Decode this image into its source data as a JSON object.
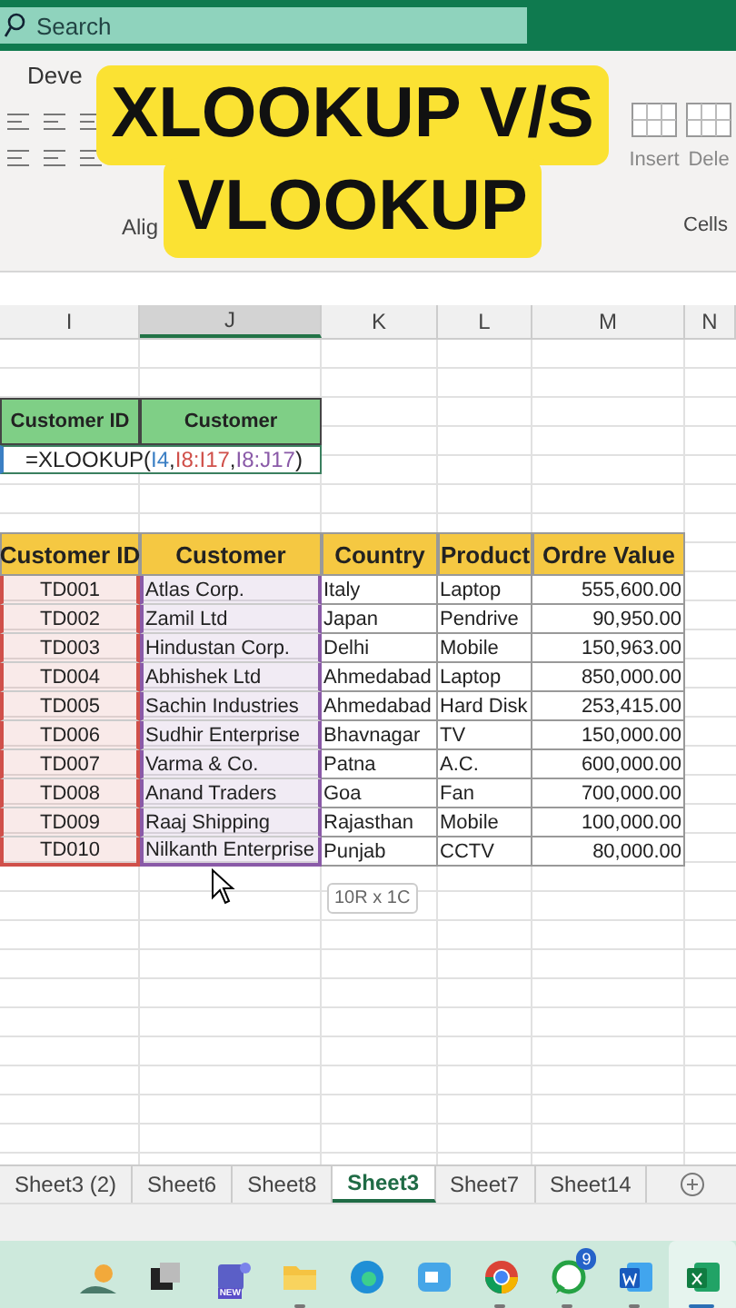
{
  "search": {
    "placeholder": "Search"
  },
  "ribbon": {
    "tab": "Deve",
    "alignment_group": "Alig",
    "insert_button": "Insert",
    "delete_button": "Dele",
    "cells_group": "Cells"
  },
  "title_overlay": {
    "lines": [
      "XLOOKUP V/S",
      "VLOOKUP"
    ]
  },
  "columns": [
    {
      "letter": "I",
      "selected": false
    },
    {
      "letter": "J",
      "selected": true
    },
    {
      "letter": "K",
      "selected": false
    },
    {
      "letter": "L",
      "selected": false
    },
    {
      "letter": "M",
      "selected": false
    },
    {
      "letter": "N",
      "selected": false
    }
  ],
  "lookup": {
    "headers": [
      "Customer ID",
      "Customer"
    ],
    "formula": [
      {
        "text": "=XLOOKUP(",
        "color": "#222222"
      },
      {
        "text": "I4",
        "color": "#3b7fc4"
      },
      {
        "text": ",",
        "color": "#222222"
      },
      {
        "text": "I8:I17",
        "color": "#d0504a"
      },
      {
        "text": ",",
        "color": "#222222"
      },
      {
        "text": "I8:J17",
        "color": "#8a5aa8"
      },
      {
        "text": ")",
        "color": "#222222"
      }
    ]
  },
  "table": {
    "columns": [
      {
        "label": "Customer ID",
        "referenced": true
      },
      {
        "label": "Customer",
        "referenced": true
      },
      {
        "label": "Country",
        "referenced": false
      },
      {
        "label": "Product",
        "referenced": false
      },
      {
        "label": "Ordre Value",
        "referenced": false
      }
    ],
    "rows": [
      [
        "TD001",
        "Atlas Corp.",
        "Italy",
        "Laptop",
        "555,600.00"
      ],
      [
        "TD002",
        "Zamil Ltd",
        "Japan",
        "Pendrive",
        "90,950.00"
      ],
      [
        "TD003",
        "Hindustan Corp.",
        "Delhi",
        "Mobile",
        "150,963.00"
      ],
      [
        "TD004",
        "Abhishek Ltd",
        "Ahmedabad",
        "Laptop",
        "850,000.00"
      ],
      [
        "TD005",
        "Sachin Industries",
        "Ahmedabad",
        "Hard Disk",
        "253,415.00"
      ],
      [
        "TD006",
        "Sudhir Enterprise",
        "Bhavnagar",
        "TV",
        "150,000.00"
      ],
      [
        "TD007",
        "Varma & Co.",
        "Patna",
        "A.C.",
        "600,000.00"
      ],
      [
        "TD008",
        "Anand Traders",
        "Goa",
        "Fan",
        "700,000.00"
      ],
      [
        "TD009",
        "Raaj Shipping",
        "Rajasthan",
        "Mobile",
        "100,000.00"
      ],
      [
        "TD010",
        "Nilkanth Enterprise",
        "Punjab",
        "CCTV",
        "80,000.00"
      ]
    ]
  },
  "selection_tooltip": "10R x 1C",
  "sheet_tabs": [
    {
      "label": "Sheet3 (2)",
      "selected": false
    },
    {
      "label": "Sheet6",
      "selected": false
    },
    {
      "label": "Sheet8",
      "selected": false
    },
    {
      "label": "Sheet3",
      "selected": true
    },
    {
      "label": "Sheet7",
      "selected": false
    },
    {
      "label": "Sheet14",
      "selected": false
    }
  ],
  "taskbar": [
    {
      "kind": "widgets",
      "running": false
    },
    {
      "kind": "taskview",
      "running": false
    },
    {
      "kind": "teams",
      "running": false,
      "badge": "NEW"
    },
    {
      "kind": "folder",
      "running": true
    },
    {
      "kind": "edge",
      "running": false
    },
    {
      "kind": "meet",
      "running": false
    },
    {
      "kind": "chrome",
      "running": true
    },
    {
      "kind": "whatsapp",
      "running": true,
      "badge": "9"
    },
    {
      "kind": "word",
      "running": true
    },
    {
      "kind": "excel",
      "running": true,
      "selected": true
    }
  ]
}
